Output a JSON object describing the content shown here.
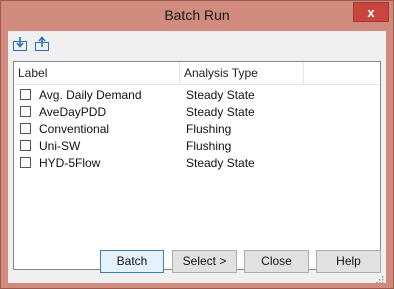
{
  "window": {
    "title": "Batch Run",
    "close_glyph": "x"
  },
  "toolbar": {
    "icons": [
      "import-icon",
      "export-icon"
    ]
  },
  "list": {
    "columns": [
      "Label",
      "Analysis Type"
    ],
    "rows": [
      {
        "label": "Avg. Daily Demand",
        "type": "Steady State",
        "checked": false
      },
      {
        "label": "AveDayPDD",
        "type": "Steady State",
        "checked": false
      },
      {
        "label": "Conventional",
        "type": "Flushing",
        "checked": false
      },
      {
        "label": "Uni-SW",
        "type": "Flushing",
        "checked": false
      },
      {
        "label": "HYD-5Flow",
        "type": "Steady State",
        "checked": false
      }
    ]
  },
  "buttons": {
    "batch": "Batch",
    "select": "Select >",
    "close": "Close",
    "help": "Help"
  },
  "colors": {
    "frame": "#d08a7e",
    "close_button": "#c9463d",
    "icon_blue": "#2a6fb8"
  }
}
